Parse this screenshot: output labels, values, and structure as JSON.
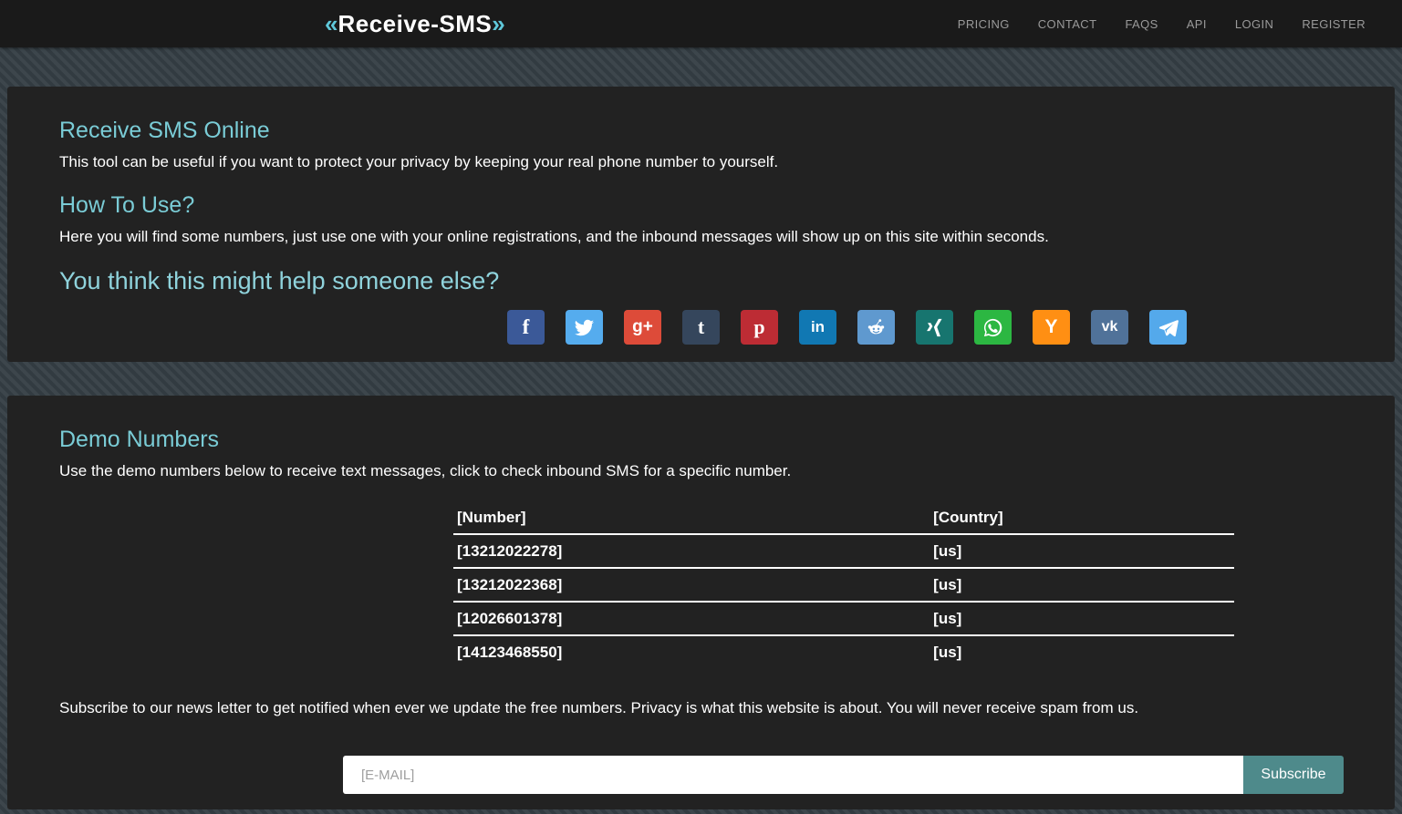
{
  "navbar": {
    "brand": {
      "prefix": "«",
      "name": "Receive-SMS",
      "suffix": "»"
    },
    "links": [
      {
        "label": "PRICING"
      },
      {
        "label": "CONTACT"
      },
      {
        "label": "FAQS"
      },
      {
        "label": "API"
      },
      {
        "label": "LOGIN"
      },
      {
        "label": "REGISTER"
      }
    ]
  },
  "intro": {
    "heading": "Receive SMS Online",
    "text": "This tool can be useful if you want to protect your privacy by keeping your real phone number to yourself.",
    "how_heading": "How To Use?",
    "how_text": "Here you will find some numbers, just use one with your online registrations, and the inbound messages will show up on this site within seconds.",
    "share_heading": "You think this might help someone else?",
    "social": [
      {
        "name": "facebook",
        "glyph": "f",
        "color": "#3b5998"
      },
      {
        "name": "twitter",
        "color": "#55acee"
      },
      {
        "name": "google-plus",
        "glyph": "g+",
        "color": "#dd4b39"
      },
      {
        "name": "tumblr",
        "glyph": "t",
        "color": "#35465c"
      },
      {
        "name": "pinterest",
        "glyph": "p",
        "color": "#bd2c34"
      },
      {
        "name": "linkedin",
        "glyph": "in",
        "color": "#1178b3"
      },
      {
        "name": "reddit",
        "color": "#5f99cf"
      },
      {
        "name": "xing",
        "color": "#17756f"
      },
      {
        "name": "whatsapp",
        "color": "#2cb742"
      },
      {
        "name": "yahoo",
        "glyph": "Y",
        "color": "#ff8f13"
      },
      {
        "name": "vk",
        "glyph": "vk",
        "color": "#507299"
      },
      {
        "name": "telegram",
        "color": "#54a9eb"
      }
    ]
  },
  "demo": {
    "heading": "Demo Numbers",
    "text": "Use the demo numbers below to receive text messages, click to check inbound SMS for a specific number.",
    "table": {
      "headers": [
        "[Number]",
        "[Country]"
      ],
      "rows": [
        [
          "[13212022278]",
          "[us]"
        ],
        [
          "[13212022368]",
          "[us]"
        ],
        [
          "[12026601378]",
          "[us]"
        ],
        [
          "[14123468550]",
          "[us]"
        ]
      ]
    },
    "subscribe_text": "Subscribe to our news letter to get notified when ever we update the free numbers. Privacy is what this website is about. You will never receive spam from us.",
    "form": {
      "placeholder": "[E-MAIL]",
      "button": "Subscribe"
    }
  },
  "colors": {
    "accent_heading": "#7accd6",
    "navbar_bg": "#1a1a1a",
    "panel_bg": "#222222",
    "stripe_bg_light": "#3d464c",
    "stripe_bg_dark": "#323b41",
    "subscribe_button": "#4e8a8b"
  }
}
